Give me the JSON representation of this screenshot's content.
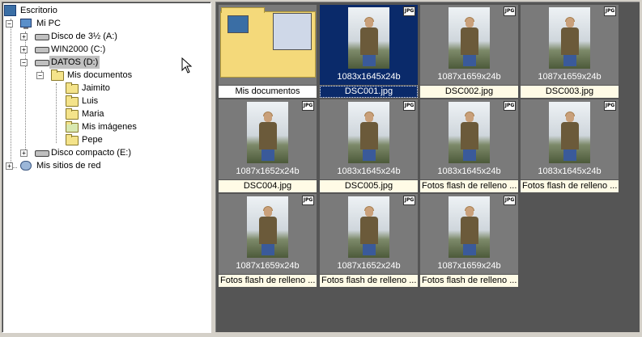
{
  "tree": {
    "desktop": "Escritorio",
    "my_pc": "Mi PC",
    "floppy": "Disco de 3½ (A:)",
    "win2000": "WIN2000 (C:)",
    "datos": "DATOS (D:)",
    "mis_documentos": "Mis documentos",
    "jaimito": "Jaimito",
    "luis": "Luis",
    "maria": "Maria",
    "mis_imagenes": "Mis imágenes",
    "pepe": "Pepe",
    "cd": "Disco compacto (E:)",
    "network": "Mis sitios de red"
  },
  "thumbs": [
    {
      "dims": "",
      "caption": "Mis documentos",
      "kind": "folder"
    },
    {
      "dims": "1083x1645x24b",
      "caption": "DSC001.jpg",
      "kind": "photo",
      "selected": true
    },
    {
      "dims": "1087x1659x24b",
      "caption": "DSC002.jpg",
      "kind": "photo"
    },
    {
      "dims": "1087x1659x24b",
      "caption": "DSC003.jpg",
      "kind": "photo"
    },
    {
      "dims": "1087x1652x24b",
      "caption": "DSC004.jpg",
      "kind": "photo"
    },
    {
      "dims": "1083x1645x24b",
      "caption": "DSC005.jpg",
      "kind": "photo"
    },
    {
      "dims": "1083x1645x24b",
      "caption": "Fotos flash de relleno ...",
      "kind": "photo"
    },
    {
      "dims": "1083x1645x24b",
      "caption": "Fotos flash de relleno ...",
      "kind": "photo"
    },
    {
      "dims": "1087x1659x24b",
      "caption": "Fotos flash de relleno ...",
      "kind": "photo"
    },
    {
      "dims": "1087x1652x24b",
      "caption": "Fotos flash de relleno ...",
      "kind": "photo"
    },
    {
      "dims": "1087x1659x24b",
      "caption": "Fotos flash de relleno ...",
      "kind": "photo"
    }
  ],
  "jpg_badge": "JPG"
}
